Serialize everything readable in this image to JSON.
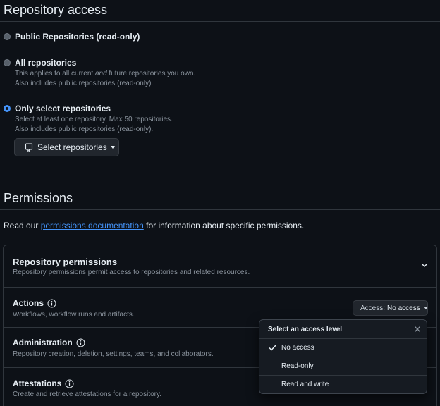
{
  "repo_access": {
    "title": "Repository access",
    "options": [
      {
        "label": "Public Repositories (read-only)",
        "desc1": "",
        "desc2": "",
        "checked": false
      },
      {
        "label": "All repositories",
        "desc1_pre": "This applies to all current ",
        "desc1_em": "and",
        "desc1_post": " future repositories you own.",
        "desc2": "Also includes public repositories (read-only).",
        "checked": false
      },
      {
        "label": "Only select repositories",
        "desc1": "Select at least one repository. Max 50 repositories.",
        "desc2": "Also includes public repositories (read-only).",
        "checked": true
      }
    ],
    "select_button_label": "Select repositories"
  },
  "permissions": {
    "title": "Permissions",
    "intro_pre": "Read our ",
    "intro_link": "permissions documentation",
    "intro_post": " for information about specific permissions.",
    "repo_perms": {
      "title": "Repository permissions",
      "desc": "Repository permissions permit access to repositories and related resources."
    },
    "rows": [
      {
        "name": "Actions",
        "desc": "Workflows, workflow runs and artifacts."
      },
      {
        "name": "Administration",
        "desc": "Repository creation, deletion, settings, teams, and collaborators."
      },
      {
        "name": "Attestations",
        "desc": "Create and retrieve attestations for a repository."
      }
    ],
    "access_button": {
      "prefix": "Access:",
      "value": "No access"
    }
  },
  "dropdown": {
    "title": "Select an access level",
    "items": [
      {
        "label": "No access",
        "selected": true
      },
      {
        "label": "Read-only",
        "selected": false
      },
      {
        "label": "Read and write",
        "selected": false
      }
    ]
  },
  "colors": {
    "background": "#0d1117",
    "accent": "#4493f8",
    "border": "#30363d",
    "muted_text": "#8b949e"
  }
}
